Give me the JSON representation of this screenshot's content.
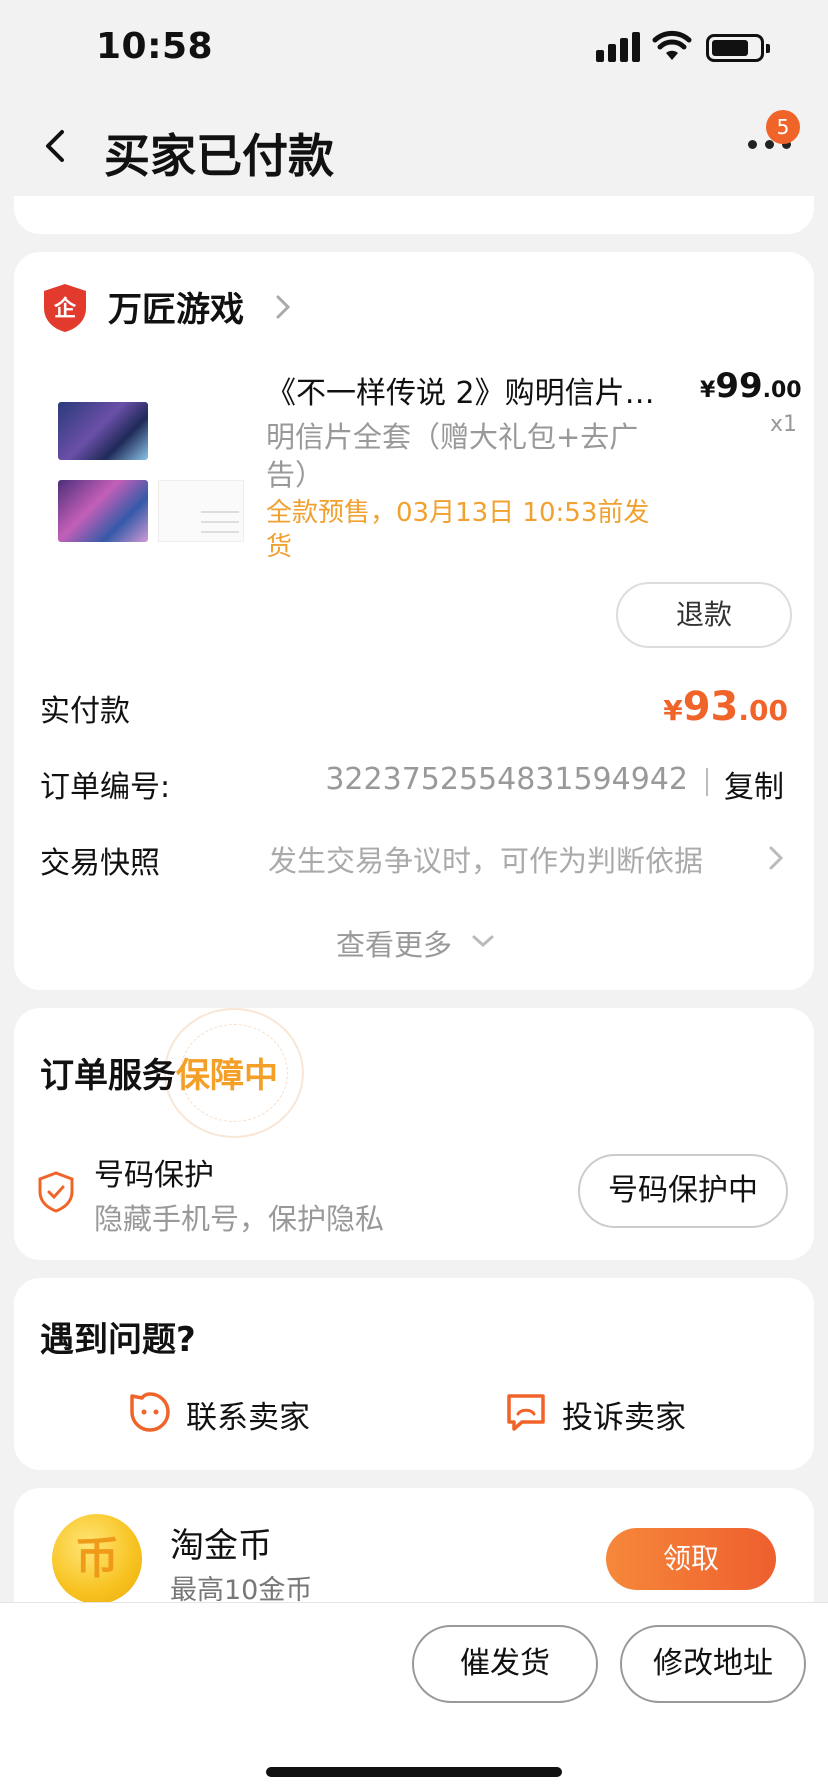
{
  "status_bar": {
    "time": "10:58"
  },
  "nav": {
    "title": "买家已付款",
    "badge_count": "5"
  },
  "shop": {
    "name": "万匠游戏"
  },
  "product": {
    "title": "《不一样传说 2》购明信片…",
    "price_symbol": "¥",
    "price_main": "99",
    "price_decimal": ".00",
    "quantity": "x1",
    "spec": "明信片全套（赠大礼包+去广告）",
    "presale_note": "全款预售，03月13日 10:53前发货",
    "refund_label": "退款"
  },
  "order": {
    "paid_label": "实付款",
    "paid_symbol": "¥",
    "paid_main": "93",
    "paid_decimal": ".00",
    "number_label": "订单编号:",
    "number_value": "3223752554831594942",
    "copy_label": "复制",
    "snapshot_label": "交易快照",
    "snapshot_hint": "发生交易争议时，可作为判断依据",
    "view_more": "查看更多"
  },
  "service": {
    "title_prefix": "订单服务",
    "title_highlight": "保障中",
    "protect_name": "号码保护",
    "protect_desc": "隐藏手机号，保护隐私",
    "protect_button": "号码保护中"
  },
  "problem": {
    "title": "遇到问题?",
    "contact_seller": "联系卖家",
    "complain_seller": "投诉卖家"
  },
  "coin": {
    "title": "淘金币",
    "desc": "最高10金币",
    "claim_button": "领取"
  },
  "bottom_bar": {
    "urge_button": "催发货",
    "modify_address_button": "修改地址"
  },
  "colors": {
    "accent": "#f0642a",
    "presale": "#f1a130",
    "highlight": "#f4a028"
  }
}
